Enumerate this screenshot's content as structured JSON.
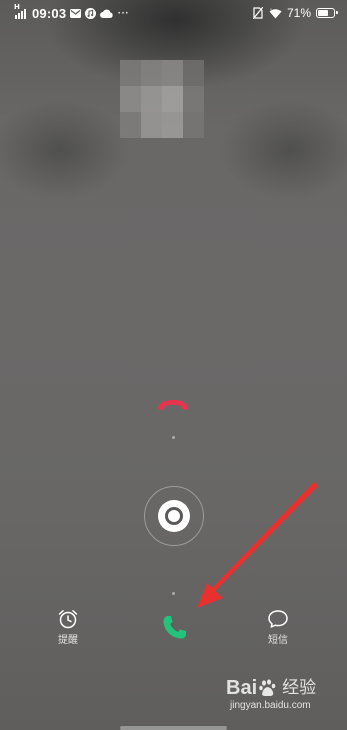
{
  "status_bar": {
    "network_label": "H",
    "time": "09:03",
    "notification_icons": [
      "mail-icon",
      "music-icon",
      "cloud-icon"
    ],
    "more_indicator": "···",
    "status_icons": [
      "no-sim-icon",
      "wifi-icon"
    ],
    "battery_percent": "71%",
    "battery_level": 0.71
  },
  "incoming_call": {
    "caller_avatar": "pixelated-avatar",
    "decline_icon": "phone-hangup-icon",
    "decline_color": "#e8334d",
    "answer_icon": "phone-answer-icon",
    "answer_color": "#22c37a",
    "slide_handle_icon": "ring-handle-icon"
  },
  "actions": {
    "remind": {
      "icon": "alarm-clock-icon",
      "label": "提醒"
    },
    "message": {
      "icon": "chat-bubble-icon",
      "label": "短信"
    }
  },
  "annotation": {
    "arrow_color": "#e8312f"
  },
  "watermark": {
    "brand_left": "Bai",
    "brand_right": "经验",
    "url": "jingyan.baidu.com"
  }
}
